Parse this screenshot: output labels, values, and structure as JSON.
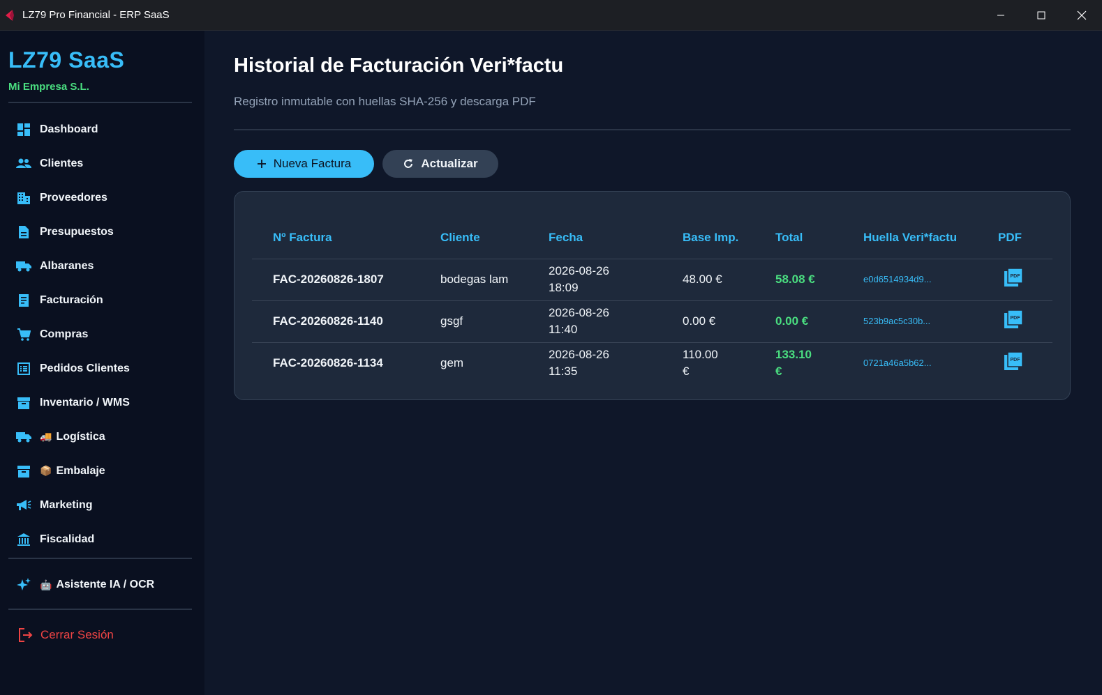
{
  "window": {
    "title": "LZ79 Pro Financial - ERP SaaS"
  },
  "sidebar": {
    "brand": "LZ79 SaaS",
    "company": "Mi Empresa S.L.",
    "items": [
      {
        "label": "Dashboard",
        "icon": "dashboard-icon"
      },
      {
        "label": "Clientes",
        "icon": "people-icon"
      },
      {
        "label": "Proveedores",
        "icon": "building-icon"
      },
      {
        "label": "Presupuestos",
        "icon": "document-icon"
      },
      {
        "label": "Albaranes",
        "icon": "truck-icon"
      },
      {
        "label": "Facturación",
        "icon": "receipt-icon"
      },
      {
        "label": "Compras",
        "icon": "cart-icon"
      },
      {
        "label": "Pedidos Clientes",
        "icon": "list-icon"
      },
      {
        "label": "Inventario / WMS",
        "icon": "archive-icon"
      },
      {
        "label": "Logística",
        "icon": "truck-icon",
        "emoji": "🚚"
      },
      {
        "label": "Embalaje",
        "icon": "archive-icon",
        "emoji": "📦"
      },
      {
        "label": "Marketing",
        "icon": "megaphone-icon"
      },
      {
        "label": "Fiscalidad",
        "icon": "bank-icon"
      }
    ],
    "ai": {
      "label": "Asistente IA / OCR",
      "emoji": "🤖"
    },
    "logout": "Cerrar Sesión"
  },
  "main": {
    "title": "Historial de Facturación Veri*factu",
    "subtitle": "Registro inmutable con huellas SHA-256 y descarga PDF",
    "new_button": "Nueva Factura",
    "refresh_button": "Actualizar",
    "table": {
      "headers": [
        "Nº Factura",
        "Cliente",
        "Fecha",
        "Base Imp.",
        "Total",
        "Huella Veri*factu",
        "PDF"
      ],
      "rows": [
        {
          "numero": "FAC-20260826-1807",
          "cliente": "bodegas lam",
          "fecha": "2026-08-26 18:09",
          "base": "48.00 €",
          "total": "58.08 €",
          "huella": "e0d6514934d9..."
        },
        {
          "numero": "FAC-20260826-1140",
          "cliente": "gsgf",
          "fecha": "2026-08-26 11:40",
          "base": "0.00 €",
          "total": "0.00 €",
          "huella": "523b9ac5c30b..."
        },
        {
          "numero": "FAC-20260826-1134",
          "cliente": "gem",
          "fecha": "2026-08-26 11:35",
          "base": "110.00 €",
          "total": "133.10 €",
          "huella": "0721a46a5b62..."
        }
      ]
    }
  },
  "colors": {
    "accent": "#38bdf8",
    "success": "#4ade80",
    "danger": "#ef4444"
  }
}
